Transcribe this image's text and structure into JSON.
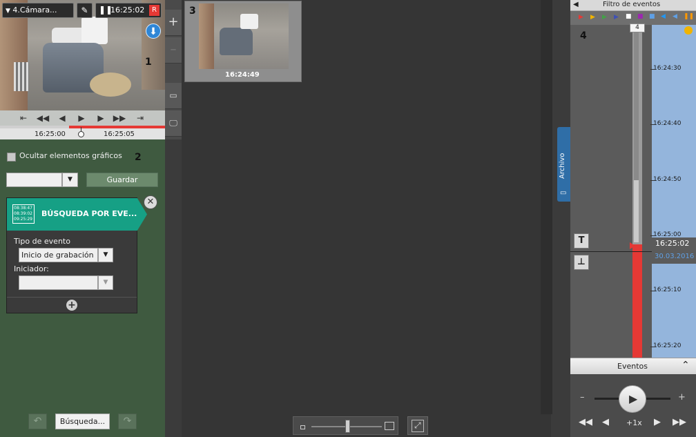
{
  "camera": {
    "name": "4.Cámara...",
    "time": "16:25:02",
    "rec_badge": "R",
    "annotation": "1",
    "timeline_labels": [
      "16:25:00",
      "16:25:05"
    ]
  },
  "search": {
    "annotation": "2",
    "hide_graphics_label": "Ocultar elementos gráficos",
    "save_button": "Guardar",
    "panel_title": "BÚSQUEDA POR EVE...",
    "event_type_label": "Tipo de evento",
    "event_type_value": "Inicio de grabación",
    "initiator_label": "Iniciador:",
    "search_button": "Búsqueda..."
  },
  "tile": {
    "annotation": "3",
    "time": "16:24:49"
  },
  "archive_tab": {
    "label": "Archivo"
  },
  "timeline": {
    "header": "Filtro de eventos",
    "annotation": "4",
    "scroll_badge": "4",
    "ticks": [
      "16:24:30",
      "16:24:40",
      "16:24:50",
      "16:25:00",
      "16:25:10",
      "16:25:20"
    ],
    "cursor_time": "16:25:02",
    "cursor_date": "30.03.2016",
    "events_label": "Eventos",
    "speed": "+1x",
    "minus": "–",
    "plus": "+",
    "filter_colors": [
      "#e53935",
      "#f0b400",
      "#43a047",
      "#3f51b5",
      "#ffffff",
      "#9c27b0",
      "#5fa0e6",
      "#2196f3",
      "#5fa0e6",
      "#ff9800"
    ]
  },
  "colors": {
    "left_bg": "#3f5a40",
    "accent_teal": "#16a085",
    "record_red": "#e53935",
    "timeline_blue": "#94b5dc"
  }
}
